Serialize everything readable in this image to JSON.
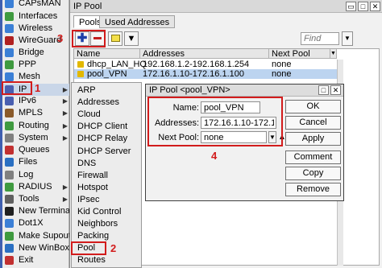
{
  "main_menu": {
    "items": [
      {
        "label": "CAPsMAN",
        "icon": "capsman-icon",
        "color": "#3b7fd6"
      },
      {
        "label": "Interfaces",
        "icon": "interfaces-icon",
        "color": "#3f9a3f"
      },
      {
        "label": "Wireless",
        "icon": "wireless-icon",
        "color": "#3b7fd6"
      },
      {
        "label": "WireGuard",
        "icon": "wireguard-icon",
        "color": "#b02020"
      },
      {
        "label": "Bridge",
        "icon": "bridge-icon",
        "color": "#3b7fd6"
      },
      {
        "label": "PPP",
        "icon": "ppp-icon",
        "color": "#3f9a3f"
      },
      {
        "label": "Mesh",
        "icon": "mesh-icon",
        "color": "#3b7fd6"
      },
      {
        "label": "IP",
        "icon": "ip-icon",
        "color": "#4a5fb0"
      },
      {
        "label": "IPv6",
        "icon": "ipv6-icon",
        "color": "#4a5fb0"
      },
      {
        "label": "MPLS",
        "icon": "mpls-icon",
        "color": "#8a5a2a"
      },
      {
        "label": "Routing",
        "icon": "routing-icon",
        "color": "#3f9a3f"
      },
      {
        "label": "System",
        "icon": "system-icon",
        "color": "#808080"
      },
      {
        "label": "Queues",
        "icon": "queues-icon",
        "color": "#c23030"
      },
      {
        "label": "Files",
        "icon": "files-icon",
        "color": "#2a6fc2"
      },
      {
        "label": "Log",
        "icon": "log-icon",
        "color": "#808080"
      },
      {
        "label": "RADIUS",
        "icon": "radius-icon",
        "color": "#3f9a3f"
      },
      {
        "label": "Tools",
        "icon": "tools-icon",
        "color": "#606060"
      },
      {
        "label": "New Terminal",
        "icon": "terminal-icon",
        "color": "#202020"
      },
      {
        "label": "Dot1X",
        "icon": "dot1x-icon",
        "color": "#3b7fd6"
      },
      {
        "label": "Make Supout.rif",
        "icon": "supout-icon",
        "color": "#3f9a3f"
      },
      {
        "label": "New WinBox",
        "icon": "winbox-icon",
        "color": "#2a6fc2"
      },
      {
        "label": "Exit",
        "icon": "exit-icon",
        "color": "#c23030"
      }
    ]
  },
  "submenu": {
    "items": [
      "ARP",
      "Addresses",
      "Cloud",
      "DHCP Client",
      "DHCP Relay",
      "DHCP Server",
      "DNS",
      "Firewall",
      "Hotspot",
      "IPsec",
      "Kid Control",
      "Neighbors",
      "Packing",
      "Pool",
      "Routes"
    ]
  },
  "pool_window": {
    "title": "IP Pool",
    "tabs": [
      "Pools",
      "Used Addresses"
    ],
    "find_placeholder": "Find",
    "columns": [
      "Name",
      "Addresses",
      "Next Pool"
    ],
    "rows": [
      {
        "name": "dhcp_LAN_HQ",
        "addresses": "192.168.1.2-192.168.1.254",
        "next_pool": "none"
      },
      {
        "name": "pool_VPN",
        "addresses": "172.16.1.10-172.16.1.100",
        "next_pool": "none"
      }
    ]
  },
  "dialog": {
    "title": "IP Pool <pool_VPN>",
    "name_label": "Name:",
    "name_value": "pool_VPN",
    "addresses_label": "Addresses:",
    "addresses_value": "172.16.1.10-172.16.1.100",
    "next_pool_label": "Next Pool:",
    "next_pool_value": "none",
    "buttons": [
      "OK",
      "Cancel",
      "Apply",
      "Comment",
      "Copy",
      "Remove"
    ]
  },
  "callouts": [
    "1",
    "2",
    "3",
    "4"
  ],
  "colors": {
    "callout": "#d21c1c",
    "selection": "#bcd4f0",
    "menu_selection": "#c9d6e8"
  }
}
